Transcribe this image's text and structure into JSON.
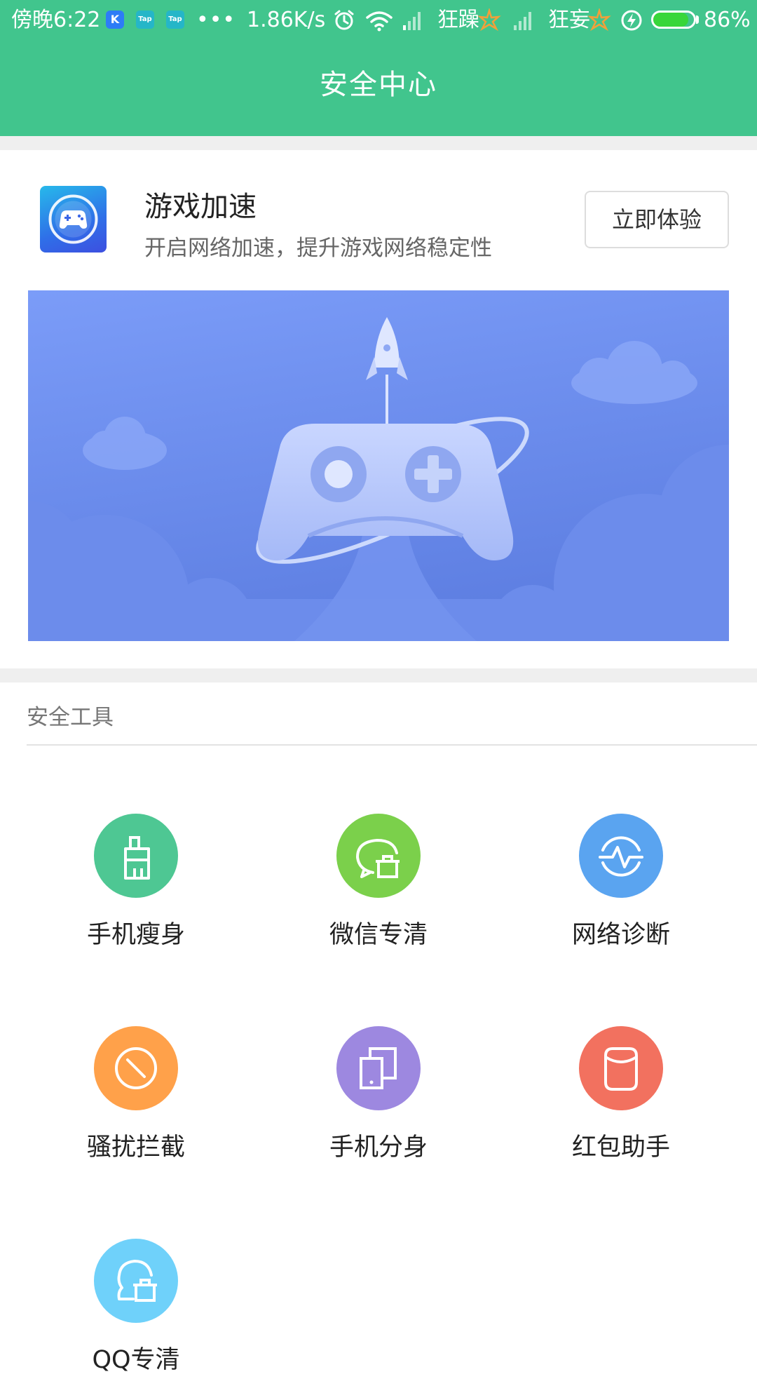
{
  "status_bar": {
    "time": "傍晚6:22",
    "app_badges": [
      "K",
      "Tap",
      "Tap"
    ],
    "more": "•••",
    "net_speed": "1.86K/s",
    "carrier1": "狂躁",
    "carrier2": "狂妄",
    "battery_percent": "86%",
    "battery_level": 0.86,
    "icons": [
      "alarm-icon",
      "wifi-icon",
      "signal-icon",
      "charging-icon",
      "battery-icon"
    ]
  },
  "header": {
    "title": "安全中心",
    "color": "#41c58d"
  },
  "promo": {
    "icon": "gamepad-icon",
    "title": "游戏加速",
    "subtitle": "开启网络加速，提升游戏网络稳定性",
    "button_label": "立即体验"
  },
  "tools": {
    "section_title": "安全工具",
    "items": [
      {
        "label": "手机瘦身",
        "icon": "broom-icon",
        "color": "#4ec793"
      },
      {
        "label": "微信专清",
        "icon": "wechat-clean-icon",
        "color": "#7bd04b"
      },
      {
        "label": "网络诊断",
        "icon": "network-diagnosis-icon",
        "color": "#5aa4f0"
      },
      {
        "label": "骚扰拦截",
        "icon": "block-icon",
        "color": "#ffa14a"
      },
      {
        "label": "手机分身",
        "icon": "dual-phone-icon",
        "color": "#9d88e0"
      },
      {
        "label": "红包助手",
        "icon": "red-packet-icon",
        "color": "#f2715f"
      },
      {
        "label": "QQ专清",
        "icon": "qq-clean-icon",
        "color": "#6fd1fa"
      }
    ]
  }
}
